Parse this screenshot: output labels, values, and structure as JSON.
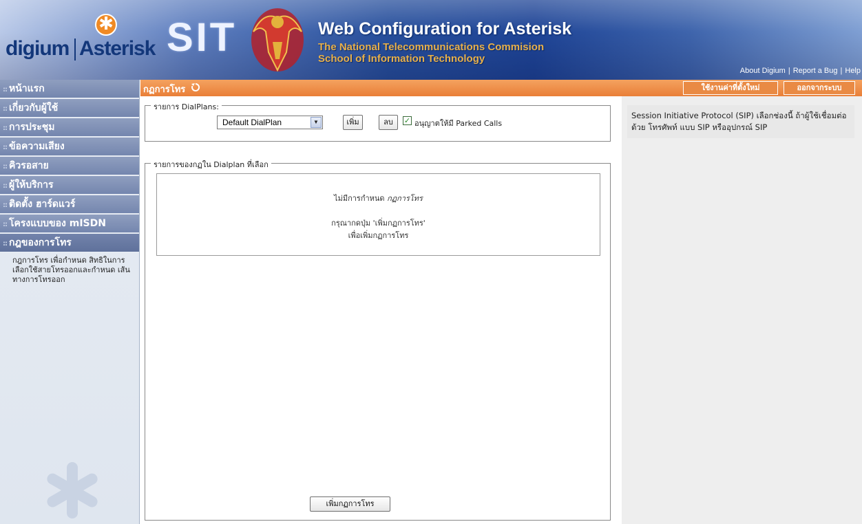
{
  "header": {
    "brand_digium": "digium",
    "brand_asterisk": "Asterisk",
    "brand_sit": "SIT",
    "title": "Web Configuration for Asterisk",
    "subtitle1": "The National Telecommunications Commision",
    "subtitle2": "School of Information Technology",
    "links": [
      "About Digium",
      "Report a Bug",
      "Help"
    ]
  },
  "sidebar": {
    "items": [
      {
        "label": "หน้าแรก"
      },
      {
        "label": "เกี่ยวกับผู้ใช้"
      },
      {
        "label": "การประชุม"
      },
      {
        "label": "ข้อความเสียง"
      },
      {
        "label": "คิวรอสาย"
      },
      {
        "label": "ผู้ให้บริการ"
      },
      {
        "label": "ติดตั้ง ฮาร์ดแวร์"
      },
      {
        "label": "โครงแบบของ mISDN"
      },
      {
        "label": "กฎของการโทร"
      }
    ],
    "active_index": 8,
    "description": "กฎการโทร เพื่อกำหนด สิทธิในการเลือกใช้สายโทรออกและกำหนด เส้นทางการโทรออก"
  },
  "titlebar": {
    "title": "กฏการโทร",
    "apply_label": "ใช้งานค่าที่ตั้งใหม่",
    "logout_label": "ออกจากระบบ"
  },
  "dialplans": {
    "legend": "รายการ DialPlans:",
    "selected": "Default DialPlan",
    "add_label": "เพิ่ม",
    "delete_label": "ลบ",
    "parked_checked": true,
    "parked_label": "อนุญาตให้มี Parked Calls"
  },
  "rules": {
    "legend": "รายการของกฏใน Dialplan ที่เลือก",
    "empty_prefix": "ไม่มีการกำหนด",
    "empty_emph": "กฏการโทร",
    "hint_line1": "กรุณากดปุ่ม 'เพิ่มกฏการโทร'",
    "hint_line2": "เพื่อเพิ่มกฏการโทร",
    "add_rule_label": "เพิ่มกฏการโทร"
  },
  "help": {
    "text": "Session Initiative Protocol (SIP) เลือกช่องนี้ ถ้าผู้ใช้เชื่อมต่อด้วย โทรศัพท์ แบบ SIP หรืออุปกรณ์ SIP"
  },
  "colors": {
    "titlebar": "#e97f38",
    "nav": "#7486ae",
    "banner": "#274f9c"
  }
}
